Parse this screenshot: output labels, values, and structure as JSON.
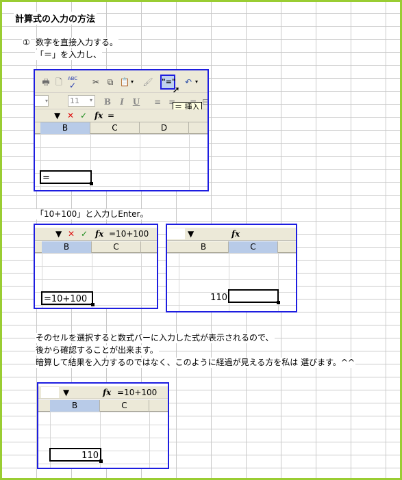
{
  "heading": "計算式の入力の方法",
  "step1": {
    "number": "①",
    "line1": "数字を直接入力する。",
    "line2": "「＝」を入力し、"
  },
  "screen1": {
    "toolbar_icons": [
      "print-icon",
      "print-preview-icon",
      "spellcheck-icon",
      "cut-icon",
      "copy-icon",
      "paste-icon",
      "format-painter-icon",
      "insert-equals-icon",
      "undo-icon"
    ],
    "spell_label": "ABC",
    "font_size": "11",
    "bold": "B",
    "italic": "I",
    "underline": "U",
    "insert_button_label": "\"=\"",
    "tooltip": "＝ 挿入",
    "cancel": "✕",
    "enter": "✓",
    "fx": "fx",
    "formula": "=",
    "columns": [
      "B",
      "C",
      "D"
    ],
    "selected_column": "B",
    "active_cell_value": "="
  },
  "step2_text": "「10+100」と入力しEnter。",
  "screen2": {
    "cancel": "✕",
    "enter": "✓",
    "fx": "fx",
    "formula": "=10+100",
    "columns": [
      "B",
      "C"
    ],
    "active_cell_value": "=10+100"
  },
  "screen3": {
    "fx": "fx",
    "formula": "",
    "columns": [
      "B",
      "C"
    ],
    "cell_value": "110"
  },
  "explanation": [
    "そのセルを選択すると数式バーに入力した式が表示されるので、",
    "後から確認することが出来ます。",
    "暗算して結果を入力するのではなく、このように経過が見える方を私は 選びます。^^"
  ],
  "screen4": {
    "fx": "fx",
    "formula": "=10+100",
    "columns": [
      "B",
      "C"
    ],
    "active_cell_value": "110"
  },
  "colors": {
    "frame_border": "#9acd32",
    "screen_border": "#1d1de0",
    "toolbar_bg": "#ece9d8",
    "selected_header": "#b8cbe8"
  }
}
